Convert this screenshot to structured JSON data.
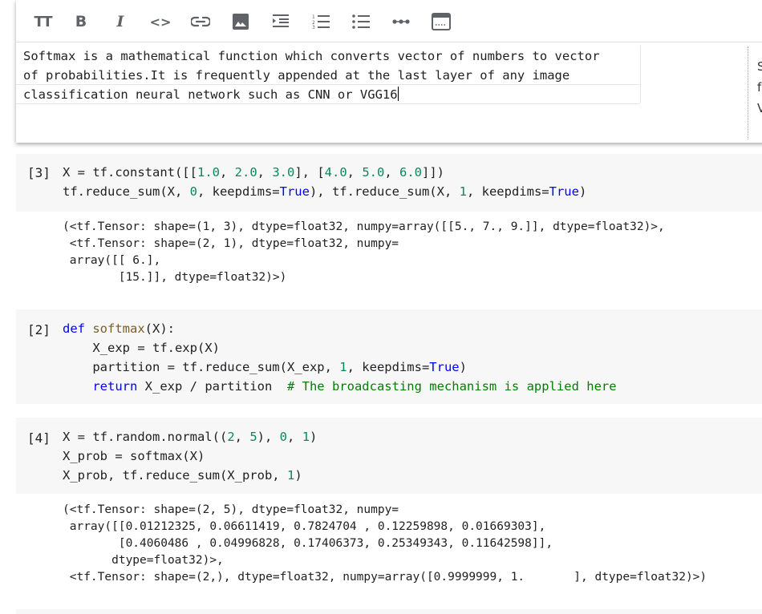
{
  "toolbar": {
    "buttons": [
      {
        "name": "text-size-icon",
        "label": "TT"
      },
      {
        "name": "bold-icon",
        "label": "B"
      },
      {
        "name": "italic-icon",
        "label": "I"
      },
      {
        "name": "code-icon",
        "label": "<>"
      },
      {
        "name": "link-icon"
      },
      {
        "name": "image-icon"
      },
      {
        "name": "indent-icon"
      },
      {
        "name": "numbered-list-icon"
      },
      {
        "name": "bulleted-list-icon"
      },
      {
        "name": "horizontal-rule-icon",
        "label": "•••"
      },
      {
        "name": "window-icon"
      }
    ]
  },
  "text_cell": {
    "line1": "Softmax is a mathematical function which converts vector of numbers to vector",
    "line2": "of probabilities.It is frequently appended at the last layer of any image",
    "line3": "classification neural network such as CNN or VGG16",
    "preview_chars": [
      "S",
      "f",
      "V"
    ]
  },
  "cells": [
    {
      "exec_count": "[3]",
      "code": [
        [
          {
            "t": "X = tf.constant([["
          },
          {
            "t": "1.0",
            "c": "num"
          },
          {
            "t": ", "
          },
          {
            "t": "2.0",
            "c": "num"
          },
          {
            "t": ", "
          },
          {
            "t": "3.0",
            "c": "num"
          },
          {
            "t": "], ["
          },
          {
            "t": "4.0",
            "c": "num"
          },
          {
            "t": ", "
          },
          {
            "t": "5.0",
            "c": "num"
          },
          {
            "t": ", "
          },
          {
            "t": "6.0",
            "c": "num"
          },
          {
            "t": "]])"
          }
        ],
        [
          {
            "t": "tf.reduce_sum(X, "
          },
          {
            "t": "0",
            "c": "num"
          },
          {
            "t": ", keepdims="
          },
          {
            "t": "True",
            "c": "kw"
          },
          {
            "t": "), tf.reduce_sum(X, "
          },
          {
            "t": "1",
            "c": "num"
          },
          {
            "t": ", keepdims="
          },
          {
            "t": "True",
            "c": "kw"
          },
          {
            "t": ")"
          }
        ]
      ],
      "output": [
        "(<tf.Tensor: shape=(1, 3), dtype=float32, numpy=array([[5., 7., 9.]], dtype=float32)>,",
        " <tf.Tensor: shape=(2, 1), dtype=float32, numpy=",
        " array([[ 6.],",
        "        [15.]], dtype=float32)>)"
      ]
    },
    {
      "exec_count": "[2]",
      "code": [
        [
          {
            "t": "def",
            "c": "kw"
          },
          {
            "t": " "
          },
          {
            "t": "softmax",
            "c": "fn"
          },
          {
            "t": "(X):"
          }
        ],
        [
          {
            "t": "    X_exp = tf.exp(X)"
          }
        ],
        [
          {
            "t": "    partition = tf.reduce_sum(X_exp, "
          },
          {
            "t": "1",
            "c": "num"
          },
          {
            "t": ", keepdims="
          },
          {
            "t": "True",
            "c": "kw"
          },
          {
            "t": ")"
          }
        ],
        [
          {
            "t": "    "
          },
          {
            "t": "return",
            "c": "kw"
          },
          {
            "t": " X_exp / partition  "
          },
          {
            "t": "# The broadcasting mechanism is applied here",
            "c": "cm"
          }
        ]
      ],
      "output": []
    },
    {
      "exec_count": "[4]",
      "code": [
        [
          {
            "t": "X = tf.random.normal(("
          },
          {
            "t": "2",
            "c": "num"
          },
          {
            "t": ", "
          },
          {
            "t": "5",
            "c": "num"
          },
          {
            "t": "), "
          },
          {
            "t": "0",
            "c": "num"
          },
          {
            "t": ", "
          },
          {
            "t": "1",
            "c": "num"
          },
          {
            "t": ")"
          }
        ],
        [
          {
            "t": "X_prob = softmax(X)"
          }
        ],
        [
          {
            "t": "X_prob, tf.reduce_sum(X_prob, "
          },
          {
            "t": "1",
            "c": "num"
          },
          {
            "t": ")"
          }
        ]
      ],
      "output": [
        "(<tf.Tensor: shape=(2, 5), dtype=float32, numpy=",
        " array([[0.01212325, 0.06611419, 0.7824704 , 0.12259898, 0.01669303],",
        "        [0.4060486 , 0.04996828, 0.17406373, 0.25349343, 0.11642598]],",
        "       dtype=float32)>,",
        " <tf.Tensor: shape=(2,), dtype=float32, numpy=array([0.9999999, 1.       ], dtype=float32)>)"
      ]
    }
  ]
}
